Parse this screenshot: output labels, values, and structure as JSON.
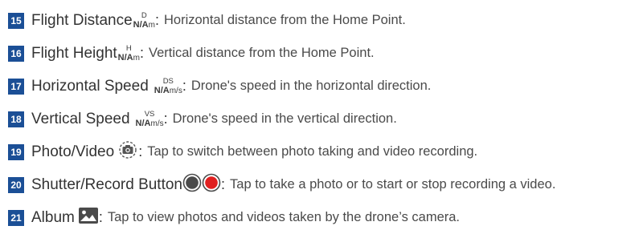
{
  "items": [
    {
      "num": "15",
      "term": "Flight Distance",
      "value_label": "D",
      "value_na": "N/A",
      "value_unit": "m",
      "sep": ":",
      "desc": "Horizontal distance from the Home Point."
    },
    {
      "num": "16",
      "term": "Flight Height",
      "value_label": "H",
      "value_na": "N/A",
      "value_unit": "m",
      "sep": ":",
      "desc": "Vertical distance from the Home Point."
    },
    {
      "num": "17",
      "term": "Horizontal Speed",
      "value_label": "DS",
      "value_na": "N/A",
      "value_unit": "m/s",
      "sep": ":",
      "desc": "Drone's speed in the horizontal direction."
    },
    {
      "num": "18",
      "term": "Vertical Speed",
      "value_label": "VS",
      "value_na": "N/A",
      "value_unit": "m/s",
      "sep": ":",
      "desc": "Drone's speed in the vertical direction."
    },
    {
      "num": "19",
      "term": "Photo/Video",
      "icon": "camera-switch-icon",
      "sep": ":",
      "desc": "Tap to switch between photo taking and video recording."
    },
    {
      "num": "20",
      "term": "Shutter/Record Button",
      "icons": [
        "shutter-button-icon",
        "record-button-icon"
      ],
      "sep": ":",
      "desc": "Tap to take a photo or to start or stop recording a video."
    },
    {
      "num": "21",
      "term": "Album",
      "icon": "album-icon",
      "sep": ":",
      "desc": "Tap to view photos and videos taken by the drone’s camera."
    }
  ],
  "colors": {
    "badge": "#1b4f96",
    "shutter": "#4a4a4a",
    "record": "#e02020"
  }
}
